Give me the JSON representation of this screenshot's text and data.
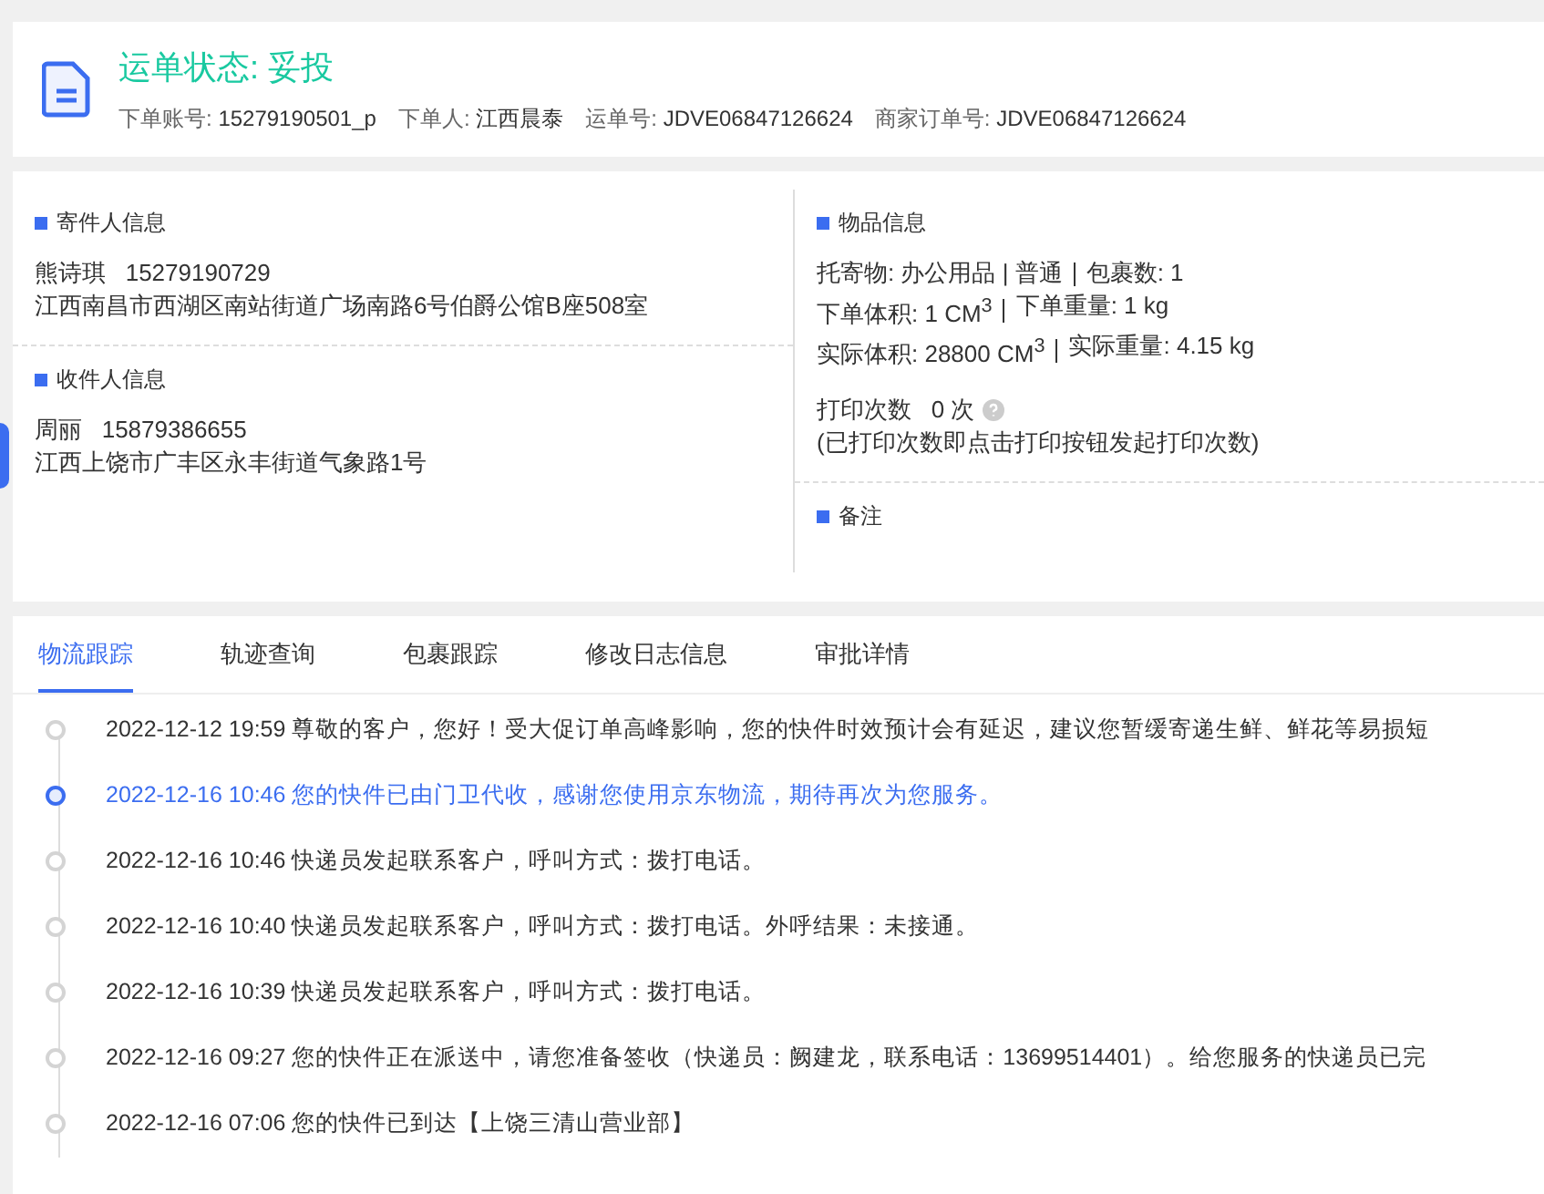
{
  "header": {
    "status": "运单状态: 妥投",
    "meta": [
      {
        "label": "下单账号:",
        "value": "15279190501_p"
      },
      {
        "label": "下单人:",
        "value": "江西晨泰"
      },
      {
        "label": "运单号:",
        "value": "JDVE06847126624"
      },
      {
        "label": "商家订单号:",
        "value": "JDVE06847126624"
      }
    ]
  },
  "sender": {
    "title": "寄件人信息",
    "name": "熊诗琪",
    "phone": "15279190729",
    "address": "江西南昌市西湖区南站街道广场南路6号伯爵公馆B座508室"
  },
  "receiver": {
    "title": "收件人信息",
    "name": "周丽",
    "phone": "15879386655",
    "address": "江西上饶市广丰区永丰街道气象路1号"
  },
  "goods": {
    "title": "物品信息",
    "lines": [
      [
        "托寄物:  办公用品 | 普通",
        "包裹数:  1"
      ],
      [
        "下单体积:   1 CM$^{3}$",
        "下单重量:  1 kg"
      ],
      [
        "实际体积:   28800 CM$^{3}$",
        "实际重量:  4.15 kg"
      ]
    ],
    "print_label": "打印次数",
    "print_count": "0 次",
    "print_note": "(已打印次数即点击打印按钮发起打印次数)"
  },
  "remarks": {
    "title": "备注"
  },
  "tabs": [
    {
      "label": "物流跟踪",
      "selected": true
    },
    {
      "label": "轨迹查询",
      "selected": false
    },
    {
      "label": "包裹跟踪",
      "selected": false
    },
    {
      "label": "修改日志信息",
      "selected": false
    },
    {
      "label": "审批详情",
      "selected": false
    }
  ],
  "timeline": [
    {
      "text": "2022-12-12 19:59 尊敬的客户，您好！受大促订单高峰影响，您的快件时效预计会有延迟，建议您暂缓寄递生鲜、鲜花等易损短",
      "selected": false
    },
    {
      "text": "2022-12-16 10:46 您的快件已由门卫代收，感谢您使用京东物流，期待再次为您服务。",
      "selected": true
    },
    {
      "text": "2022-12-16 10:46 快递员发起联系客户，呼叫方式：拨打电话。",
      "selected": false
    },
    {
      "text": "2022-12-16 10:40 快递员发起联系客户，呼叫方式：拨打电话。外呼结果：未接通。",
      "selected": false
    },
    {
      "text": "2022-12-16 10:39 快递员发起联系客户，呼叫方式：拨打电话。",
      "selected": false
    },
    {
      "text": "2022-12-16 09:27 您的快件正在派送中，请您准备签收（快递员：阙建龙，联系电话：13699514401）。给您服务的快递员已完",
      "selected": false
    },
    {
      "text": "2022-12-16 07:06 您的快件已到达【上饶三清山营业部】",
      "selected": false
    }
  ]
}
